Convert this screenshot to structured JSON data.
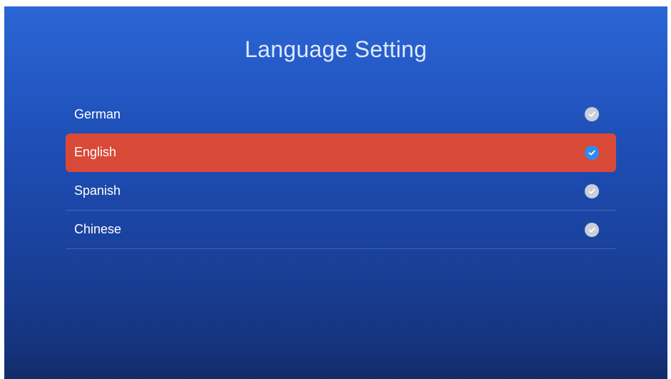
{
  "title": "Language Setting",
  "languages": [
    {
      "label": "German",
      "selected": false
    },
    {
      "label": "English",
      "selected": true
    },
    {
      "label": "Spanish",
      "selected": false
    },
    {
      "label": "Chinese",
      "selected": false
    }
  ],
  "colors": {
    "selected_bg": "#d84a37",
    "active_check": "#2f8bef",
    "inactive_check": "#c9ced8"
  },
  "icons": {
    "check": "check-circle-icon"
  }
}
